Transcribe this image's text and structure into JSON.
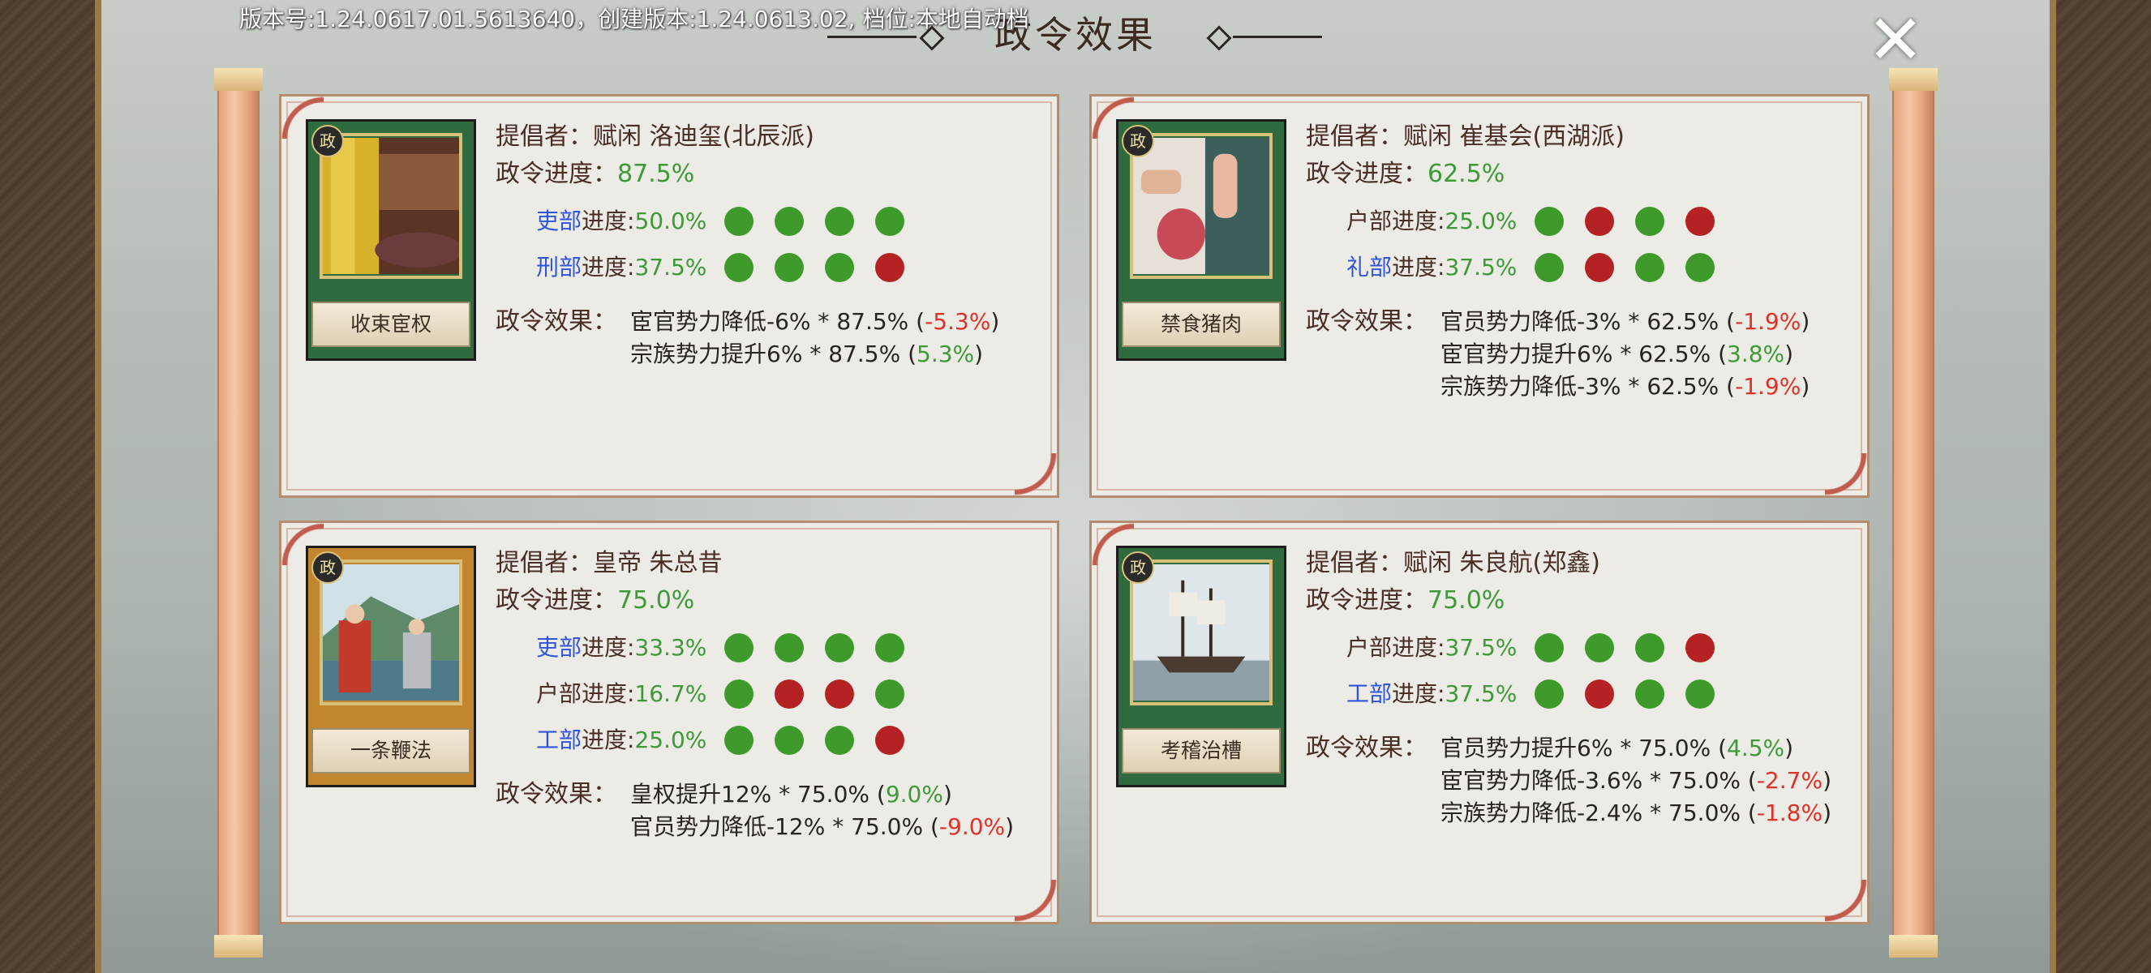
{
  "header": {
    "version_text": "版本号:1.24.0617.01.5613640，创建版本:1.24.0613.02, 档位:本地自动档",
    "title": "政令效果",
    "close_label": "✕"
  },
  "labels": {
    "proposer": "提倡者：",
    "progress": "政令进度：",
    "effect": "政令效果："
  },
  "colors": {
    "positive": "#3d9a37",
    "negative": "#e03128",
    "dept_highlight": "#2f55d8",
    "dot_green": "#3d9a2b",
    "dot_red": "#b52223"
  },
  "cards": [
    {
      "image_icon": "emperor-robe-card-art",
      "badge": "政令",
      "name": "收束宦权",
      "proposer": "赋闲 洛迪玺(北辰派)",
      "progress": "87.5%",
      "departments": [
        {
          "name": "吏部",
          "suffix": "进度:",
          "value": "50.0%",
          "highlight": true,
          "dots": [
            "g",
            "g",
            "g",
            "g"
          ]
        },
        {
          "name": "刑部",
          "suffix": "进度:",
          "value": "37.5%",
          "highlight": true,
          "dots": [
            "g",
            "g",
            "g",
            "r"
          ]
        }
      ],
      "effects": [
        {
          "text": "宦官势力降低-6% * 87.5% (",
          "result": "-5.3%",
          "sign": "neg",
          "close": ")"
        },
        {
          "text": "宗族势力提升6% * 87.5% (",
          "result": "5.3%",
          "sign": "pos",
          "close": ")"
        }
      ]
    },
    {
      "image_icon": "meat-card-art",
      "badge": "政令",
      "name": "禁食猪肉",
      "proposer": "赋闲 崔基会(西湖派)",
      "progress": "62.5%",
      "departments": [
        {
          "name": "户部",
          "suffix": "进度:",
          "value": "25.0%",
          "highlight": false,
          "dots": [
            "g",
            "r",
            "g",
            "r"
          ]
        },
        {
          "name": "礼部",
          "suffix": "进度:",
          "value": "37.5%",
          "highlight": true,
          "dots": [
            "g",
            "r",
            "g",
            "g"
          ]
        }
      ],
      "effects": [
        {
          "text": "官员势力降低-3% * 62.5% (",
          "result": "-1.9%",
          "sign": "neg",
          "close": ")"
        },
        {
          "text": "宦官势力提升6% * 62.5% (",
          "result": "3.8%",
          "sign": "pos",
          "close": ")"
        },
        {
          "text": "宗族势力降低-3% * 62.5% (",
          "result": "-1.9%",
          "sign": "neg",
          "close": ")"
        }
      ]
    },
    {
      "image_icon": "officials-meeting-card-art",
      "badge": "政令",
      "name": "一条鞭法",
      "proposer": "皇帝 朱总昔",
      "progress": "75.0%",
      "departments": [
        {
          "name": "吏部",
          "suffix": "进度:",
          "value": "33.3%",
          "highlight": true,
          "dots": [
            "g",
            "g",
            "g",
            "g"
          ]
        },
        {
          "name": "户部",
          "suffix": "进度:",
          "value": "16.7%",
          "highlight": false,
          "dots": [
            "g",
            "r",
            "r",
            "g"
          ]
        },
        {
          "name": "工部",
          "suffix": "进度:",
          "value": "25.0%",
          "highlight": true,
          "dots": [
            "g",
            "g",
            "g",
            "r"
          ]
        }
      ],
      "effects": [
        {
          "text": "皇权提升12% * 75.0% (",
          "result": "9.0%",
          "sign": "pos",
          "close": ")"
        },
        {
          "text": "官员势力降低-12% * 75.0% (",
          "result": "-9.0%",
          "sign": "neg",
          "close": ")"
        }
      ]
    },
    {
      "image_icon": "ship-card-art",
      "badge": "政令",
      "name": "考稽治槽",
      "proposer": "赋闲 朱良航(郑鑫)",
      "progress": "75.0%",
      "departments": [
        {
          "name": "户部",
          "suffix": "进度:",
          "value": "37.5%",
          "highlight": false,
          "dots": [
            "g",
            "g",
            "g",
            "r"
          ]
        },
        {
          "name": "工部",
          "suffix": "进度:",
          "value": "37.5%",
          "highlight": true,
          "dots": [
            "g",
            "r",
            "g",
            "g"
          ]
        }
      ],
      "effects": [
        {
          "text": "官员势力提升6% * 75.0% (",
          "result": "4.5%",
          "sign": "pos",
          "close": ")"
        },
        {
          "text": "宦官势力降低-3.6% * 75.0% (",
          "result": "-2.7%",
          "sign": "neg",
          "close": ")"
        },
        {
          "text": "宗族势力降低-2.4% * 75.0% (",
          "result": "-1.8%",
          "sign": "neg",
          "close": ")"
        }
      ]
    }
  ]
}
